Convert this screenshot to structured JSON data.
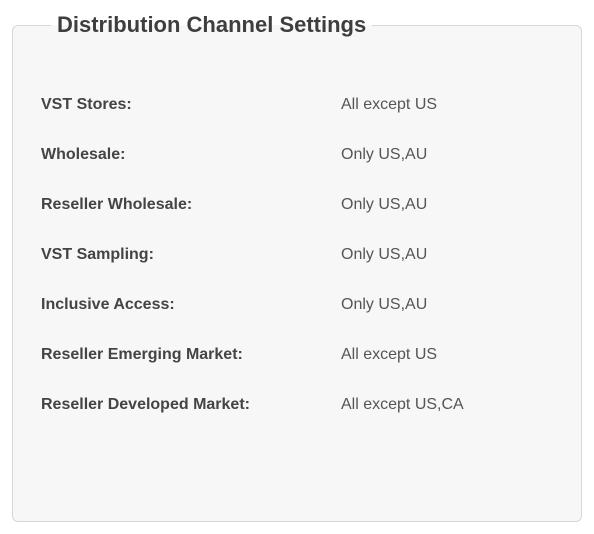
{
  "panel": {
    "title": "Distribution Channel Settings",
    "rows": [
      {
        "label": "VST Stores:",
        "value": "All except US"
      },
      {
        "label": "Wholesale:",
        "value": "Only US,AU"
      },
      {
        "label": "Reseller Wholesale:",
        "value": "Only US,AU"
      },
      {
        "label": "VST Sampling:",
        "value": "Only US,AU"
      },
      {
        "label": "Inclusive Access:",
        "value": "Only US,AU"
      },
      {
        "label": "Reseller Emerging Market:",
        "value": "All except US"
      },
      {
        "label": "Reseller Developed Market:",
        "value": "All except US,CA"
      }
    ]
  }
}
